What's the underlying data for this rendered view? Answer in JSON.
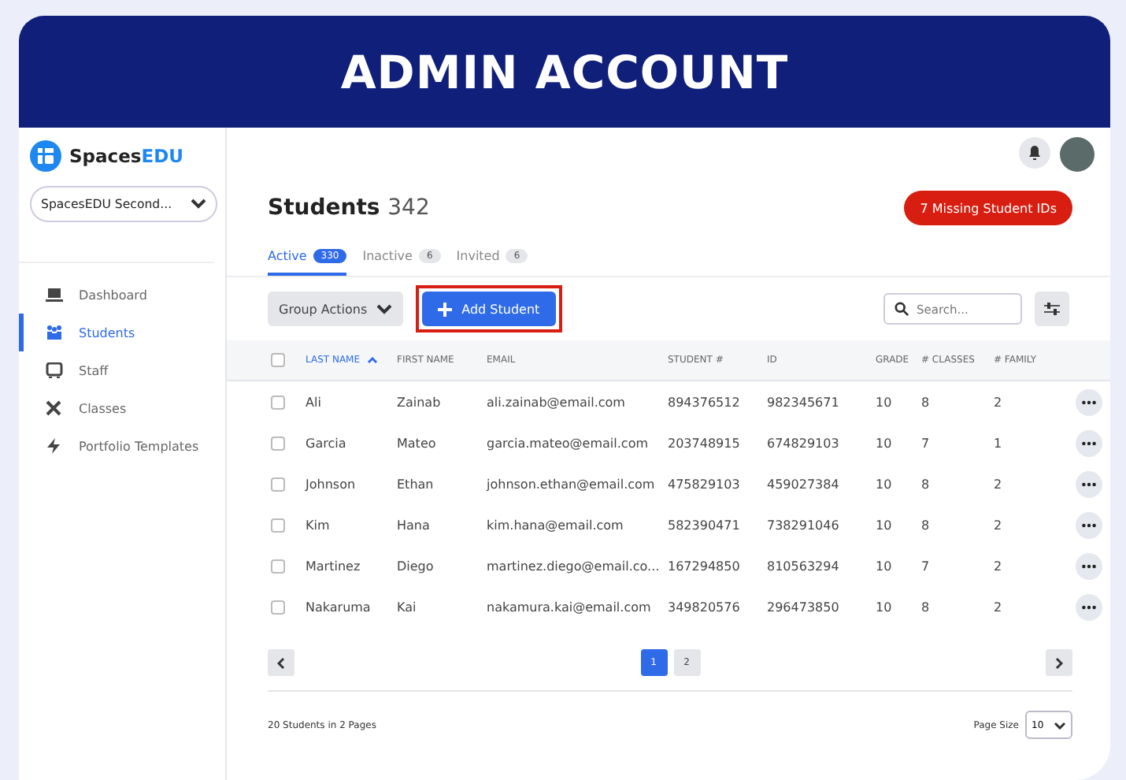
{
  "banner": {
    "title": "ADMIN ACCOUNT"
  },
  "sidebar": {
    "brand": {
      "prefix": "Spaces",
      "suffix": "EDU"
    },
    "school_select": "SpacesEDU Second...",
    "items": [
      {
        "label": "Dashboard",
        "kind": "laptop",
        "selected": false
      },
      {
        "label": "Students",
        "kind": "people",
        "selected": true
      },
      {
        "label": "Staff",
        "kind": "bus",
        "selected": false
      },
      {
        "label": "Classes",
        "kind": "tools",
        "selected": false
      },
      {
        "label": "Portfolio Templates",
        "kind": "bolt",
        "selected": false
      }
    ]
  },
  "header": {
    "title": "Students",
    "count": "342",
    "alert": "7 Missing Student IDs"
  },
  "tabs": [
    {
      "label": "Active",
      "count": "330",
      "selected": true
    },
    {
      "label": "Inactive",
      "count": "6",
      "selected": false
    },
    {
      "label": "Invited",
      "count": "6",
      "selected": false
    }
  ],
  "toolbar": {
    "group_actions": "Group Actions",
    "add_button": "Add Student",
    "add_highlighted": true,
    "search_placeholder": "Search..."
  },
  "table": {
    "all_checked": false,
    "columns": [
      {
        "label": "LAST NAME",
        "sorted": true
      },
      {
        "label": "FIRST NAME",
        "sorted": false
      },
      {
        "label": "EMAIL",
        "sorted": false
      },
      {
        "label": "STUDENT #",
        "sorted": false
      },
      {
        "label": "ID",
        "sorted": false
      },
      {
        "label": "GRADE",
        "sorted": false
      },
      {
        "label": "# CLASSES",
        "sorted": false
      },
      {
        "label": "# FAMILY",
        "sorted": false
      }
    ],
    "rows": [
      {
        "checked": false,
        "cells": [
          "Ali",
          "Zainab",
          "ali.zainab@email.com",
          "894376512",
          "982345671",
          "10",
          "8",
          "2"
        ]
      },
      {
        "checked": false,
        "cells": [
          "Garcia",
          "Mateo",
          "garcia.mateo@email.com",
          "203748915",
          "674829103",
          "10",
          "7",
          "1"
        ]
      },
      {
        "checked": false,
        "cells": [
          "Johnson",
          "Ethan",
          "johnson.ethan@email.com",
          "475829103",
          "459027384",
          "10",
          "8",
          "2"
        ]
      },
      {
        "checked": false,
        "cells": [
          "Kim",
          "Hana",
          "kim.hana@email.com",
          "582390471",
          "738291046",
          "10",
          "8",
          "2"
        ]
      },
      {
        "checked": false,
        "cells": [
          "Martinez",
          "Diego",
          "martinez.diego@email.co...",
          "167294850",
          "810563294",
          "10",
          "7",
          "2"
        ]
      },
      {
        "checked": false,
        "cells": [
          "Nakaruma",
          "Kai",
          "nakamura.kai@email.com",
          "349820576",
          "296473850",
          "10",
          "8",
          "2"
        ]
      }
    ]
  },
  "pagination": {
    "pages": [
      {
        "label": "1",
        "selected": true
      },
      {
        "label": "2",
        "selected": false
      }
    ]
  },
  "footer": {
    "summary": "20 Students in 2 Pages",
    "page_size_label": "Page Size",
    "page_size": "10"
  }
}
